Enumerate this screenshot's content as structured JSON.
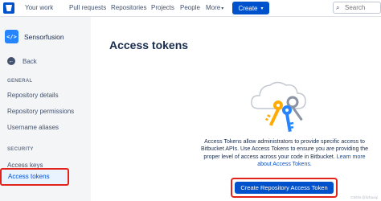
{
  "topnav": {
    "links": [
      "Your work",
      "Pull requests",
      "Repositories",
      "Projects",
      "People",
      "More"
    ],
    "create_label": "Create",
    "search_placeholder": "Search"
  },
  "sidebar": {
    "repo_name": "Sensorfusion",
    "back_label": "Back",
    "general_header": "GENERAL",
    "general_items": [
      "Repository details",
      "Repository permissions",
      "Username aliases"
    ],
    "security_header": "SECURITY",
    "security_items": [
      "Access keys",
      "Access tokens"
    ],
    "active_item": "Access tokens"
  },
  "main": {
    "title": "Access tokens",
    "description": "Access Tokens allow administrators to provide specific access to Bitbucket APIs. Use Access Tokens to ensure you are providing the proper level of access across your code in Bitbucket.",
    "learn_more_label": "Learn more about Access Tokens.",
    "create_button_label": "Create Repository Access Token"
  },
  "watermark": "CSDN @lizhaoqi",
  "colors": {
    "brand": "#0052cc",
    "highlight_outline": "#e2231a",
    "sidebar_bg": "#f4f5f7",
    "key_yellow": "#ffab00",
    "key_blue": "#2684ff"
  }
}
